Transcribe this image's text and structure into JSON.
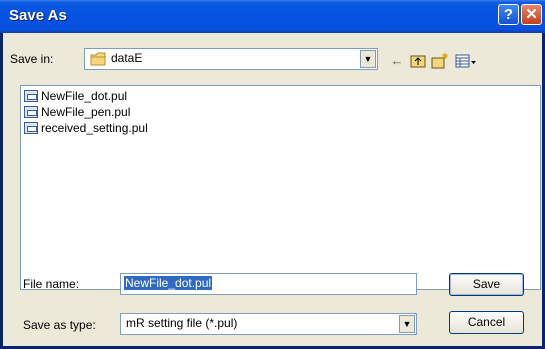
{
  "window": {
    "title": "Save As"
  },
  "titlebar": {
    "help_glyph": "?",
    "close_glyph": "✕"
  },
  "toolbar": {
    "save_in_label": "Save in:",
    "location": "dataE",
    "icons": [
      "back-arrow-icon",
      "up-folder-icon",
      "new-folder-icon",
      "view-menu-icon"
    ]
  },
  "files": [
    {
      "name": "NewFile_dot.pul"
    },
    {
      "name": "NewFile_pen.pul"
    },
    {
      "name": "received_setting.pul"
    }
  ],
  "form": {
    "filename_label": "File name:",
    "filename_value": "NewFile_dot.pul",
    "type_label": "Save as type:",
    "type_value": "mR setting file (*.pul)"
  },
  "buttons": {
    "save": "Save",
    "cancel": "Cancel"
  },
  "colors": {
    "titlebar": "#0553e3",
    "face": "#ece9d8",
    "selection": "#316ac5"
  }
}
